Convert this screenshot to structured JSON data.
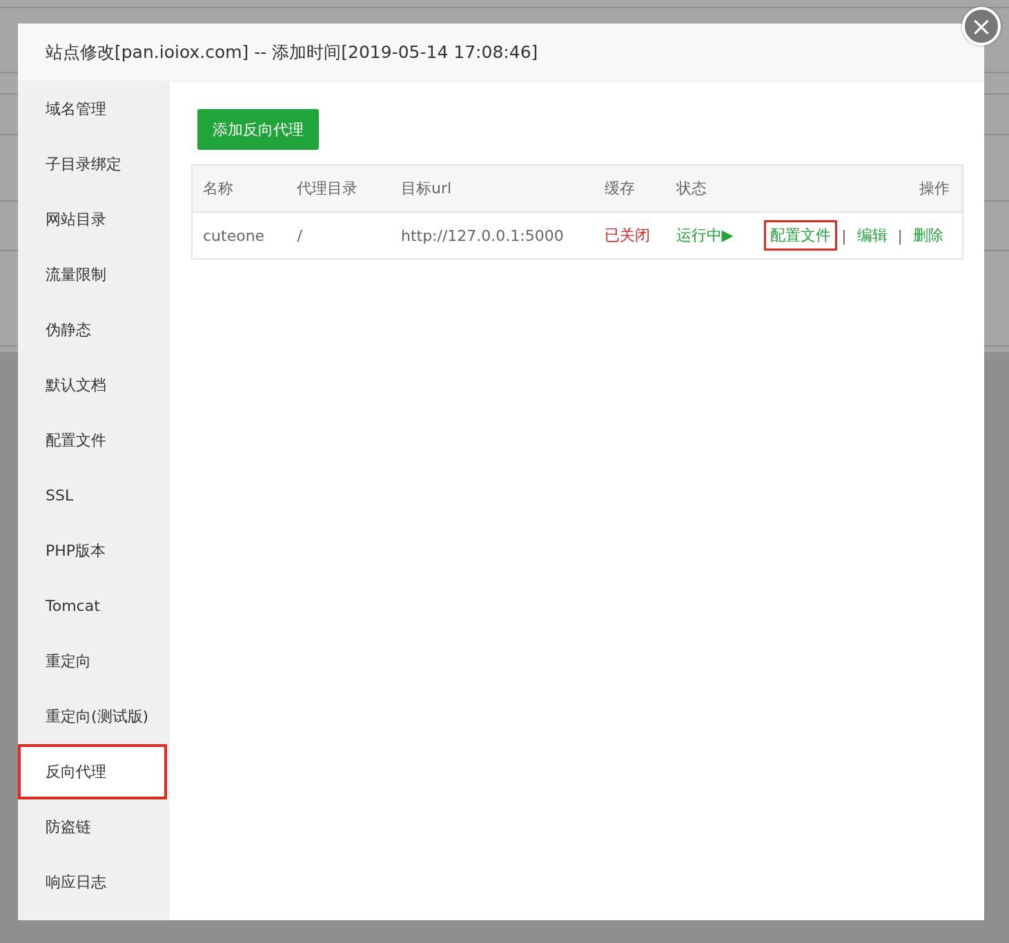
{
  "dialog": {
    "title": "站点修改[pan.ioiox.com] -- 添加时间[2019-05-14 17:08:46]",
    "close": "×"
  },
  "sidebar": {
    "items": [
      {
        "label": "域名管理",
        "selected": false,
        "annotated": false
      },
      {
        "label": "子目录绑定",
        "selected": false,
        "annotated": false
      },
      {
        "label": "网站目录",
        "selected": false,
        "annotated": false
      },
      {
        "label": "流量限制",
        "selected": false,
        "annotated": false
      },
      {
        "label": "伪静态",
        "selected": false,
        "annotated": false
      },
      {
        "label": "默认文档",
        "selected": false,
        "annotated": false
      },
      {
        "label": "配置文件",
        "selected": false,
        "annotated": false
      },
      {
        "label": "SSL",
        "selected": false,
        "annotated": false
      },
      {
        "label": "PHP版本",
        "selected": false,
        "annotated": false
      },
      {
        "label": "Tomcat",
        "selected": false,
        "annotated": false
      },
      {
        "label": "重定向",
        "selected": false,
        "annotated": false
      },
      {
        "label": "重定向(测试版)",
        "selected": false,
        "annotated": false
      },
      {
        "label": "反向代理",
        "selected": true,
        "annotated": true
      },
      {
        "label": "防盗链",
        "selected": false,
        "annotated": false
      },
      {
        "label": "响应日志",
        "selected": false,
        "annotated": false
      }
    ]
  },
  "add_button": "添加反向代理",
  "table": {
    "columns": [
      "名称",
      "代理目录",
      "目标url",
      "缓存",
      "状态",
      "操作"
    ],
    "rows": [
      {
        "name": "cuteone",
        "directory": "/",
        "target_url": "http://127.0.0.1:5000",
        "cache": {
          "text": "已关闭",
          "on": false
        },
        "status": {
          "text": "运行中▶",
          "running": true
        },
        "actions": [
          {
            "label": "配置文件",
            "annotated": true
          },
          {
            "label": "编辑",
            "annotated": false
          },
          {
            "label": "删除",
            "annotated": false
          }
        ],
        "separator": "|"
      }
    ]
  }
}
